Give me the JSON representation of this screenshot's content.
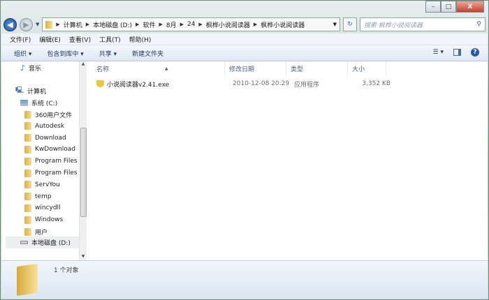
{
  "window": {
    "minimize": "–",
    "maximize": "□",
    "close": "X"
  },
  "address": {
    "crumbs": [
      "计算机",
      "本地磁盘 (D:)",
      "软件",
      "8月",
      "24",
      "枫桦小说阅读器",
      "枫桦小说阅读器"
    ],
    "search_placeholder": "搜索 枫桦小说阅读器"
  },
  "menu": [
    "文件(F)",
    "编辑(E)",
    "查看(V)",
    "工具(T)",
    "帮助(H)"
  ],
  "toolbar": {
    "organize": "组织 ▾",
    "include": "包含到库中 ▾",
    "share": "共享 ▾",
    "new_folder": "新建文件夹"
  },
  "nav": {
    "music": "音乐",
    "computer": "计算机",
    "c_drive": "系统 (C:)",
    "folders": [
      "360用户文件",
      "Autodesk",
      "Download",
      "KwDownload",
      "Program Files",
      "Program Files",
      "ServYou",
      "temp",
      "wincydll",
      "Windows",
      "用户"
    ],
    "d_drive": "本地磁盘 (D:)"
  },
  "columns": [
    "名称",
    "修改日期",
    "类型",
    "大小"
  ],
  "files": [
    {
      "name": "小说阅读器v2.41.exe",
      "modified": "2010-12-08 20:29",
      "type": "应用程序",
      "size": "3,352 KB"
    }
  ],
  "status": {
    "count": "1 个对象"
  }
}
